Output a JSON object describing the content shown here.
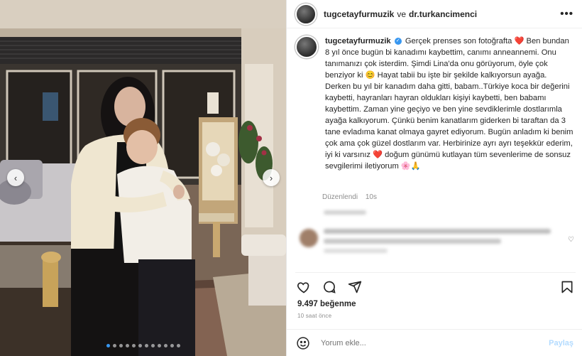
{
  "header": {
    "username": "tugcetayfurmuzik",
    "separator": "ve",
    "collaborator": "dr.turkancimenci",
    "more_label": "•••"
  },
  "caption": {
    "username": "tugcetayfurmuzik",
    "text": "Gerçek prenses son fotoğrafta ❤️ Ben bundan 8 yıl önce bugün bi kanadımı kaybettim, canımı anneannemi. Onu tanımanızı çok isterdim. Şimdi Lina'da onu görüyorum, öyle çok benziyor ki 😊 Hayat tabii bu işte bir şekilde kalkıyorsun ayağa. Derken bu yıl bir kanadım daha gitti, babam..Türkiye koca bir değerini kaybetti, hayranları hayran oldukları kişiyi kaybetti, ben babamı kaybettim. Zaman yine geçiyo ve ben yine sevdiklerimle dostlarımla ayağa kalkıyorum. Çünkü benim kanatlarım giderken bi taraftan da 3 tane evladıma kanat olmaya gayret ediyorum. Bugün anladım ki benim çok ama çok güzel dostlarım var. Herbirinize ayrı ayrı teşekkür ederim, iyi ki varsınız ❤️ doğum günümü kutlayan tüm sevenlerime de sonsuz sevgilerimi iletiyorum 🌸🙏",
    "edited_label": "Düzenlendi",
    "edited_time": "10s"
  },
  "stats": {
    "likes_count": "9.497",
    "likes_label": "beğenme",
    "posted_ago": "10 saat önce"
  },
  "comment_box": {
    "placeholder": "Yorum ekle...",
    "post_label": "Paylaş"
  },
  "carousel": {
    "slide_count": 12,
    "active_index": 0
  },
  "colors": {
    "verified": "#3897f0",
    "active_dot": "#3897f0",
    "heart": "#e0245e",
    "muted_text": "#8e8e8e"
  },
  "icons": {
    "like": "heart-icon",
    "comment": "comment-icon",
    "share": "share-icon",
    "save": "bookmark-icon",
    "emoji": "smiley-icon",
    "more": "more-options-icon",
    "prev": "chevron-left-icon",
    "next": "chevron-right-icon"
  }
}
